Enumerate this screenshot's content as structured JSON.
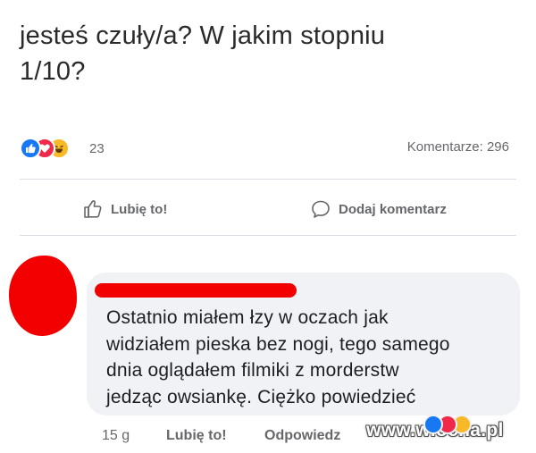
{
  "post": {
    "text_line1": "jesteś czuły/a? W jakim stopniu",
    "text_line2": "1/10?"
  },
  "stats": {
    "reaction_icons": [
      "like-icon",
      "love-icon",
      "haha-icon"
    ],
    "reaction_count": "23",
    "comments_label": "Komentarze: 296"
  },
  "actions": {
    "like_label": "Lubię to!",
    "comment_label": "Dodaj komentarz"
  },
  "comment": {
    "author_redacted": true,
    "lines": [
      "Ostatnio miałem łzy w oczach jak",
      "widziałem pieska bez nogi, tego samego",
      "dnia oglądałem filmiki z morderstw",
      "jedząc owsiankę. Ciężko powiedzieć"
    ],
    "time": "15 g",
    "like_label": "Lubię to!",
    "reply_label": "Odpowiedz",
    "reaction_icons": [
      "like-icon",
      "love-icon",
      "haha-icon"
    ]
  },
  "watermark": "www.wiocha.pl",
  "colors": {
    "like_blue": "#1877f2",
    "love_red": "#f0284a",
    "haha_yellow": "#f7b928",
    "redaction_red": "#f20000",
    "bubble_gray": "#f0f2f5"
  }
}
